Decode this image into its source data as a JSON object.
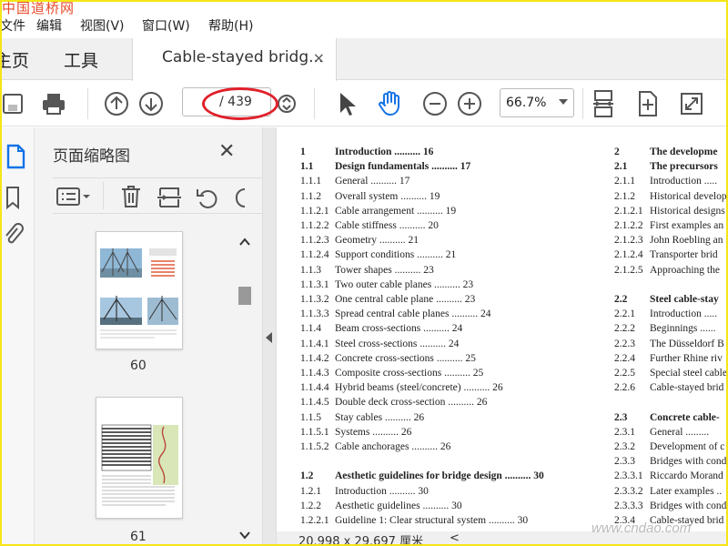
{
  "watermark": "中国道桥网",
  "menu": [
    "文件",
    "编辑",
    "视图(V)",
    "窗口(W)",
    "帮助(H)"
  ],
  "tabs": {
    "home": "主页",
    "tools": "工具"
  },
  "doc_tab": {
    "title": "Cable-stayed bridg...",
    "close": "×"
  },
  "toolbar": {
    "page_current": "",
    "page_total": "/ 439",
    "zoom": "66.7%"
  },
  "panel": {
    "title": "页面缩略图",
    "close": "✕"
  },
  "thumbnails": [
    {
      "label": "60"
    },
    {
      "label": "61"
    }
  ],
  "status": {
    "size": "20.998 x 29.697 厘米",
    "nav": "<"
  },
  "site_watermark": "www.cndao.com",
  "toc": {
    "left": [
      {
        "num": "1",
        "title": "Introduction",
        "page": "16",
        "bold": true
      },
      {
        "num": "1.1",
        "title": "Design fundamentals",
        "page": "17",
        "bold": true
      },
      {
        "num": "1.1.1",
        "title": "General",
        "page": "17"
      },
      {
        "num": "1.1.2",
        "title": "Overall system",
        "page": "19"
      },
      {
        "num": "1.1.2.1",
        "title": "Cable arrangement",
        "page": "19"
      },
      {
        "num": "1.1.2.2",
        "title": "Cable stiffness",
        "page": "20"
      },
      {
        "num": "1.1.2.3",
        "title": "Geometry",
        "page": "21"
      },
      {
        "num": "1.1.2.4",
        "title": "Support conditions",
        "page": "21"
      },
      {
        "num": "1.1.3",
        "title": "Tower shapes",
        "page": "23"
      },
      {
        "num": "1.1.3.1",
        "title": "Two outer cable planes",
        "page": "23"
      },
      {
        "num": "1.1.3.2",
        "title": "One central cable plane",
        "page": "23"
      },
      {
        "num": "1.1.3.3",
        "title": "Spread central cable planes",
        "page": "24"
      },
      {
        "num": "1.1.4",
        "title": "Beam cross-sections",
        "page": "24"
      },
      {
        "num": "1.1.4.1",
        "title": "Steel cross-sections",
        "page": "24"
      },
      {
        "num": "1.1.4.2",
        "title": "Concrete cross-sections",
        "page": "25"
      },
      {
        "num": "1.1.4.3",
        "title": "Composite cross-sections",
        "page": "25"
      },
      {
        "num": "1.1.4.4",
        "title": "Hybrid beams (steel/concrete)",
        "page": "26"
      },
      {
        "num": "1.1.4.5",
        "title": "Double deck cross-section",
        "page": "26"
      },
      {
        "num": "1.1.5",
        "title": "Stay cables",
        "page": "26"
      },
      {
        "num": "1.1.5.1",
        "title": "Systems",
        "page": "26"
      },
      {
        "num": "1.1.5.2",
        "title": "Cable anchorages",
        "page": "26"
      },
      {
        "num": "",
        "title": "",
        "page": ""
      },
      {
        "num": "1.2",
        "title": "Aesthetic guidelines for bridge design",
        "page": "30",
        "bold": true
      },
      {
        "num": "1.2.1",
        "title": "Introduction",
        "page": "30"
      },
      {
        "num": "1.2.2",
        "title": "Aesthetic guidelines",
        "page": "30"
      },
      {
        "num": "1.2.2.1",
        "title": "Guideline 1: Clear structural system",
        "page": "30"
      }
    ],
    "right": [
      {
        "num": "2",
        "title": "The developme",
        "bold": true
      },
      {
        "num": "2.1",
        "title": "The precursors",
        "bold": true
      },
      {
        "num": "2.1.1",
        "title": "Introduction ....."
      },
      {
        "num": "2.1.2",
        "title": "Historical develop"
      },
      {
        "num": "2.1.2.1",
        "title": "Historical designs"
      },
      {
        "num": "2.1.2.2",
        "title": "First examples an"
      },
      {
        "num": "2.1.2.3",
        "title": "John Roebling an"
      },
      {
        "num": "2.1.2.4",
        "title": "Transporter brid"
      },
      {
        "num": "2.1.2.5",
        "title": "Approaching the"
      },
      {
        "num": "",
        "title": ""
      },
      {
        "num": "2.2",
        "title": "Steel cable-stay",
        "bold": true
      },
      {
        "num": "2.2.1",
        "title": "Introduction ....."
      },
      {
        "num": "2.2.2",
        "title": "Beginnings ......"
      },
      {
        "num": "2.2.3",
        "title": "The Düsseldorf B"
      },
      {
        "num": "2.2.4",
        "title": "Further Rhine riv"
      },
      {
        "num": "2.2.5",
        "title": "Special steel cable"
      },
      {
        "num": "2.2.6",
        "title": "Cable-stayed brid"
      },
      {
        "num": "",
        "title": ""
      },
      {
        "num": "2.3",
        "title": "Concrete cable-",
        "bold": true
      },
      {
        "num": "2.3.1",
        "title": "General ........."
      },
      {
        "num": "2.3.2",
        "title": "Development of c"
      },
      {
        "num": "2.3.3",
        "title": "Bridges with cond"
      },
      {
        "num": "2.3.3.1",
        "title": "Riccardo Morand"
      },
      {
        "num": "2.3.3.2",
        "title": "Later examples .."
      },
      {
        "num": "2.3.3.3",
        "title": "Bridges with cond"
      },
      {
        "num": "2.3.4",
        "title": "Cable-stayed brid"
      }
    ]
  }
}
